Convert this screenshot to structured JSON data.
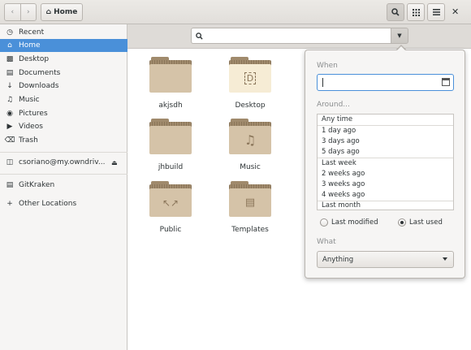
{
  "header": {
    "path_label": "Home"
  },
  "sidebar": {
    "items": [
      {
        "label": "Recent",
        "icon": "clock-icon"
      },
      {
        "label": "Home",
        "icon": "home-icon"
      },
      {
        "label": "Desktop",
        "icon": "desktop-icon"
      },
      {
        "label": "Documents",
        "icon": "document-icon"
      },
      {
        "label": "Downloads",
        "icon": "download-icon"
      },
      {
        "label": "Music",
        "icon": "music-icon"
      },
      {
        "label": "Pictures",
        "icon": "camera-icon"
      },
      {
        "label": "Videos",
        "icon": "video-icon"
      },
      {
        "label": "Trash",
        "icon": "trash-icon"
      }
    ],
    "network": [
      {
        "label": "csoriano@my.owndriv..."
      }
    ],
    "bookmarks": [
      {
        "label": "GitKraken"
      }
    ],
    "other": "Other Locations"
  },
  "folders": [
    {
      "label": "akjsdh",
      "icon": ""
    },
    {
      "label": "Desktop",
      "icon": "desktop"
    },
    {
      "label": "jhbuild",
      "icon": ""
    },
    {
      "label": "Music",
      "icon": "music"
    },
    {
      "label": "Public",
      "icon": "share"
    },
    {
      "label": "Templates",
      "icon": "template"
    }
  ],
  "popover": {
    "when_label": "When",
    "around_label": "Around...",
    "around_options": [
      "Any time",
      "1 day ago",
      "3 days ago",
      "5 days ago",
      "Last week",
      "2 weeks ago",
      "3 weeks ago",
      "4 weeks ago",
      "Last month"
    ],
    "radio_last_modified": "Last modified",
    "radio_last_used": "Last used",
    "radio_selected": "Last used",
    "what_label": "What",
    "what_value": "Anything"
  }
}
